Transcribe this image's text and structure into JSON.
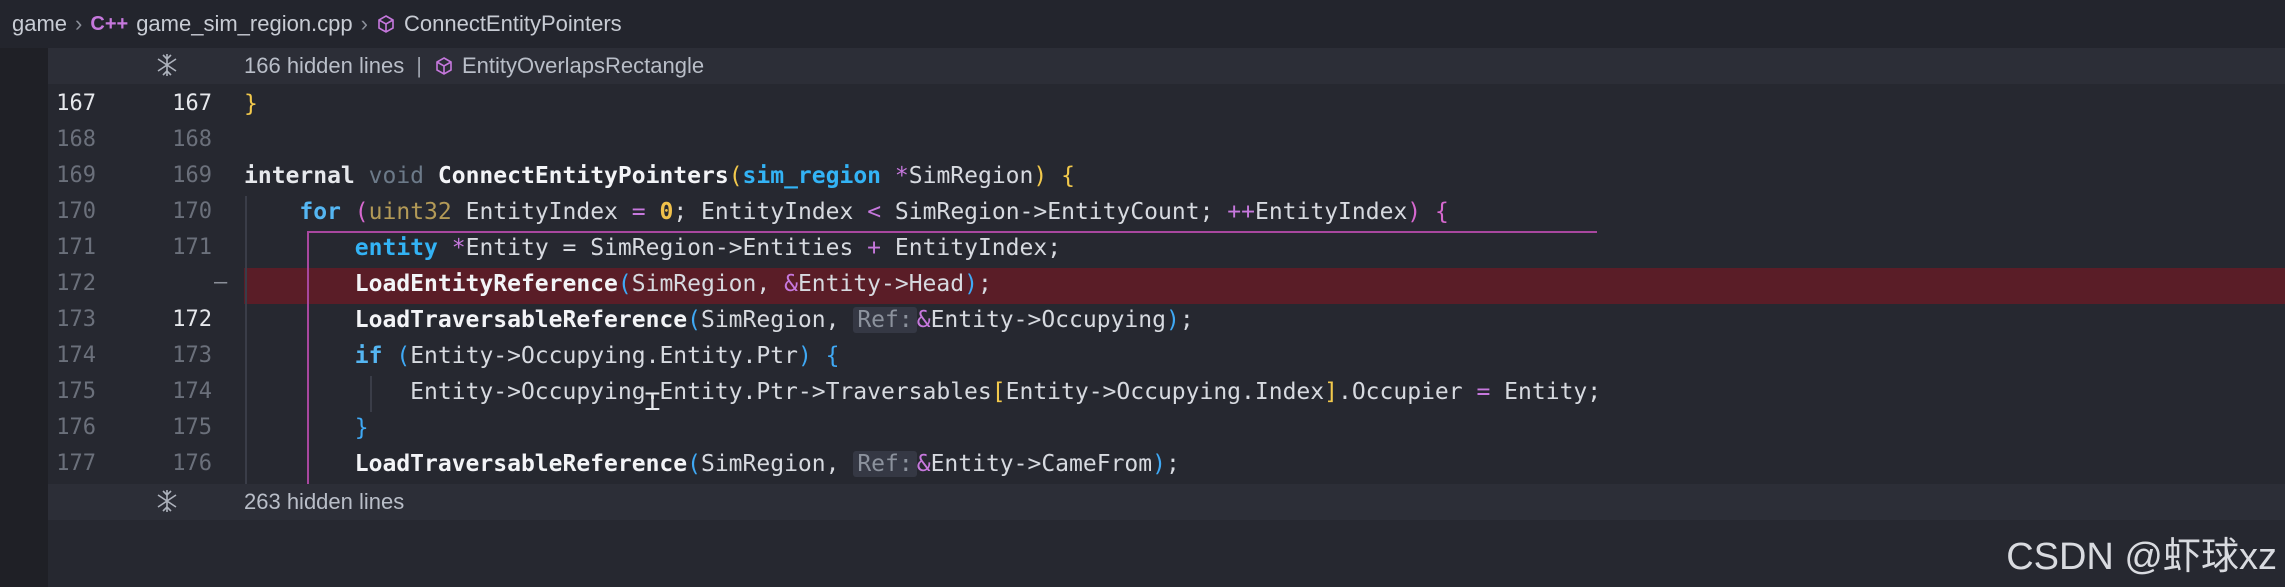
{
  "breadcrumb": {
    "folder": "game",
    "file": "game_sim_region.cpp",
    "file_icon": "C++",
    "symbol": "ConnectEntityPointers"
  },
  "folds": [
    {
      "text": "166 hidden lines",
      "symbol": "EntityOverlapsRectangle"
    },
    {
      "text": "263 hidden lines"
    }
  ],
  "lines": [
    {
      "old": "167",
      "new": "167"
    },
    {
      "old": "168",
      "new": "168"
    },
    {
      "old": "169",
      "new": "169"
    },
    {
      "old": "170",
      "new": "170"
    },
    {
      "old": "171",
      "new": "171"
    },
    {
      "old": "172",
      "new": "",
      "marker": "—"
    },
    {
      "old": "173",
      "new": "172"
    },
    {
      "old": "174",
      "new": "173"
    },
    {
      "old": "175",
      "new": "174"
    },
    {
      "old": "176",
      "new": "175"
    },
    {
      "old": "177",
      "new": "176"
    }
  ],
  "code": {
    "l167_brace": "}",
    "l169": {
      "internal": "internal",
      "void": "void",
      "fn": "ConnectEntityPointers",
      "open": "(",
      "type": "sim_region",
      "ptr": "*",
      "param": "SimRegion",
      "close": ")",
      "brace": "{"
    },
    "l170": {
      "for": "for",
      "open": "(",
      "type": "uint32",
      "decl": " EntityIndex ",
      "eq": "=",
      "zero": "0",
      "mid": "; EntityIndex ",
      "lt": "<",
      "cond": " SimRegion->EntityCount; ",
      "inc": "++",
      "var": "EntityIndex",
      "close": ")",
      "brace": "{"
    },
    "l171": {
      "type": "entity",
      "ptr": "*",
      "rest1": "Entity = SimRegion->Entities ",
      "plus": "+",
      "rest2": " EntityIndex;"
    },
    "l172": {
      "fn": "LoadEntityReference",
      "open": "(",
      "arg1": "SimRegion, ",
      "amp": "&",
      "arg2": "Entity->Head",
      "close": ")",
      "semi": ";"
    },
    "l173": {
      "fn": "LoadTraversableReference",
      "open": "(",
      "arg1": "SimRegion, ",
      "hint": "Ref:",
      "amp": "&",
      "arg2": "Entity->Occupying",
      "close": ")",
      "semi": ";"
    },
    "l174": {
      "if": "if",
      "open": "(",
      "cond": "Entity->Occupying.Entity.Ptr",
      "close": ")",
      "brace": "{"
    },
    "l175": {
      "a": "Entity->Occupying.Entity.Ptr->Traversables",
      "lb": "[",
      "b": "Entity->Occupying.Index",
      "rb": "]",
      "c": ".Occupier ",
      "eq": "=",
      "d": " Entity;"
    },
    "l176": {
      "brace": "}"
    },
    "l177": {
      "fn": "LoadTraversableReference",
      "open": "(",
      "arg1": "SimRegion, ",
      "hint": "Ref:",
      "amp": "&",
      "arg2": "Entity->CameFrom",
      "close": ")",
      "semi": ";"
    }
  },
  "watermark": "CSDN @虾球xz"
}
